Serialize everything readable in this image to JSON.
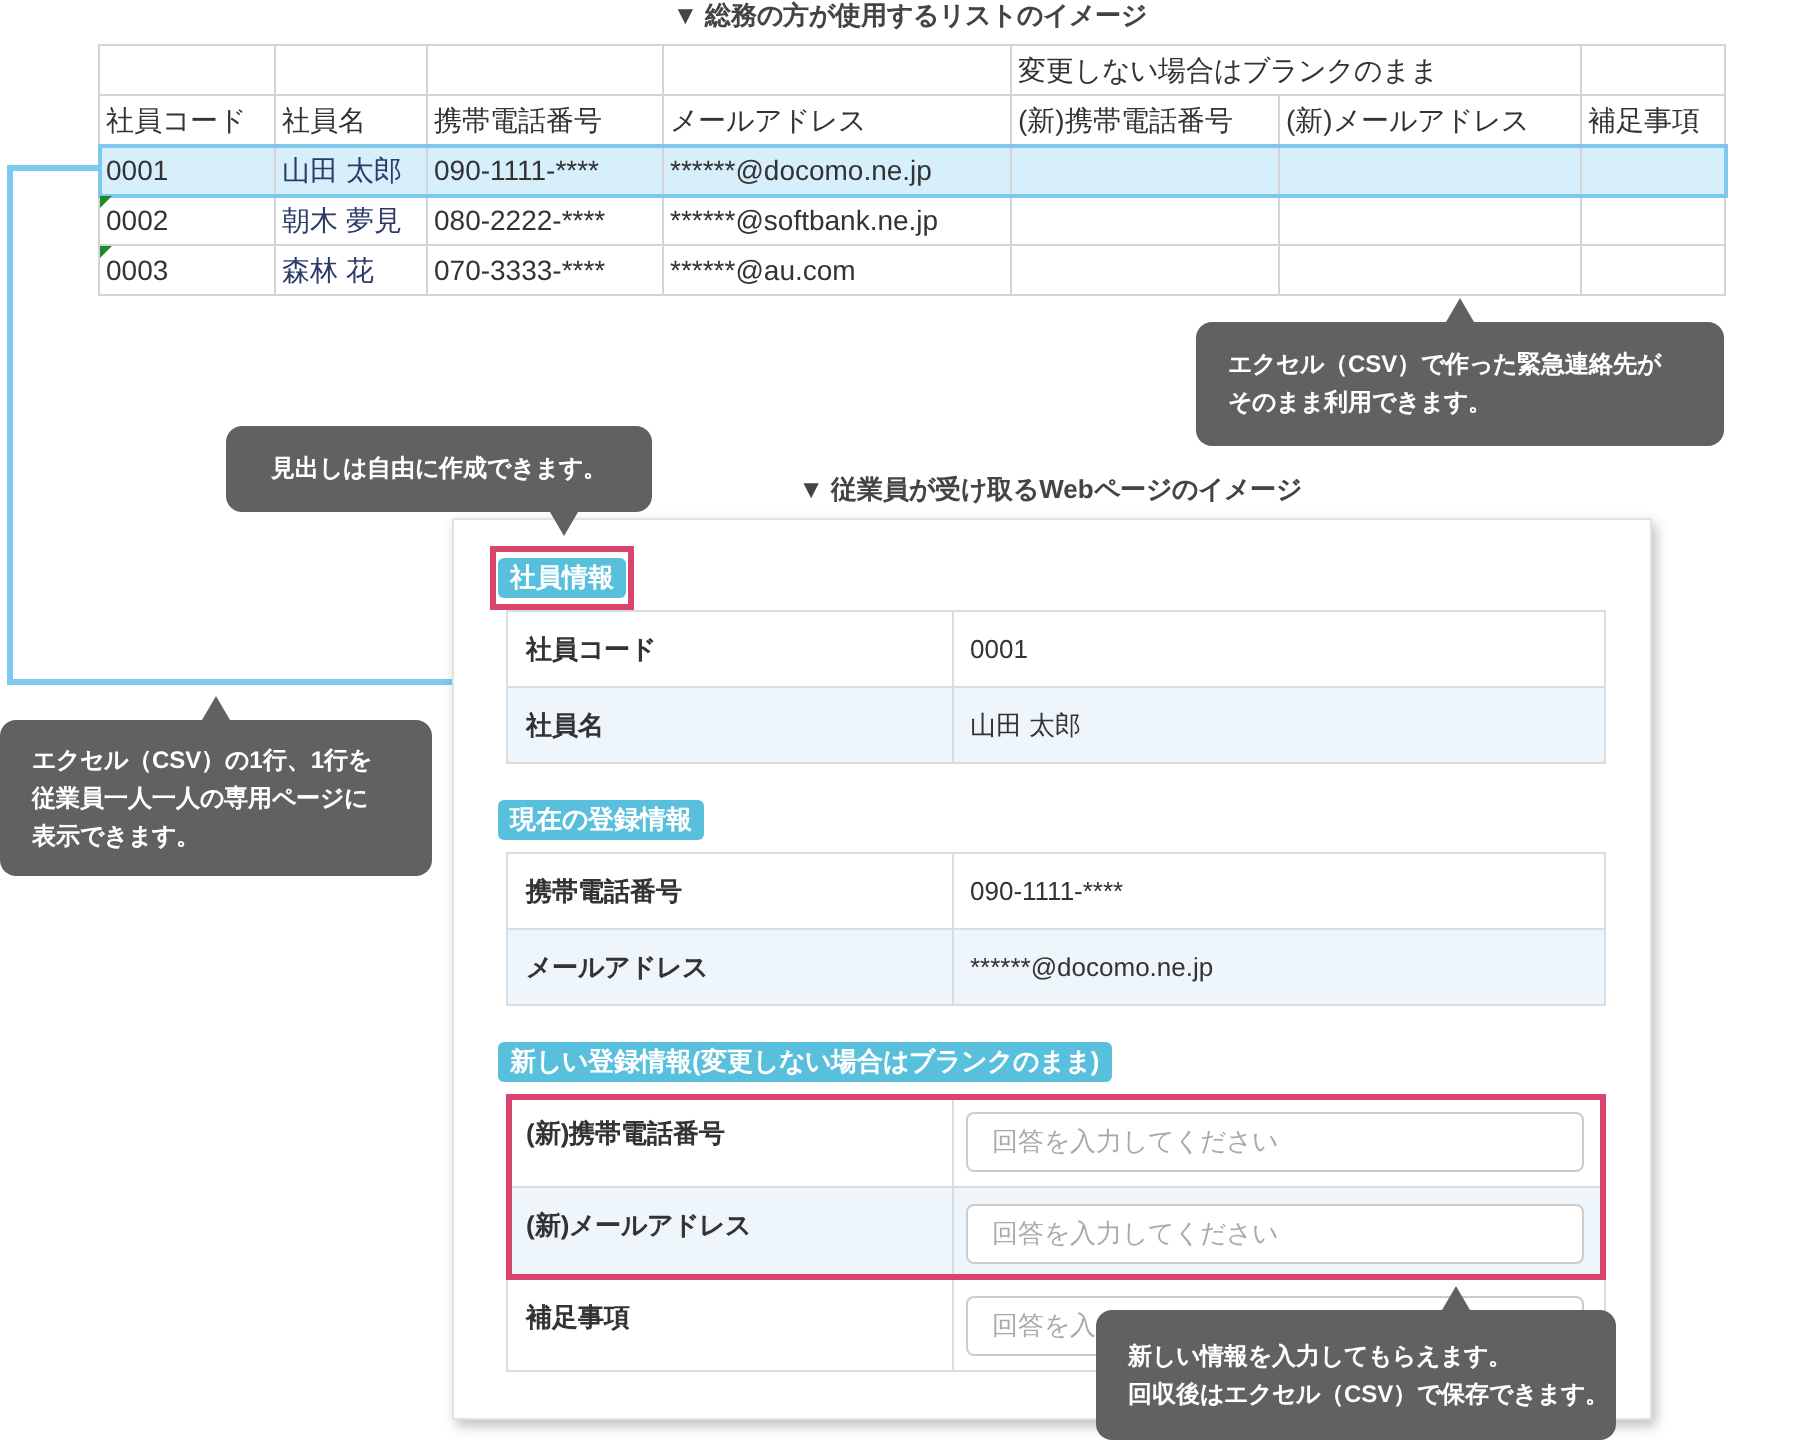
{
  "list_title": "▼ 総務の方が使用するリストのイメージ",
  "spreadsheet": {
    "group_header": "変更しない場合はブランクのまま",
    "columns": [
      "社員コード",
      "社員名",
      "携帯電話番号",
      "メールアドレス",
      "(新)携帯電話番号",
      "(新)メールアドレス",
      "補足事項"
    ],
    "rows": [
      {
        "cells": [
          "0001",
          "山田 太郎",
          "090-1111-****",
          "******@docomo.ne.jp"
        ],
        "selected": true,
        "marked": false
      },
      {
        "cells": [
          "0002",
          "朝木 夢見",
          "080-2222-****",
          "******@softbank.ne.jp"
        ],
        "selected": false,
        "marked": true
      },
      {
        "cells": [
          "0003",
          "森林 花",
          "070-3333-****",
          "******@au.com"
        ],
        "selected": false,
        "marked": true
      }
    ]
  },
  "page_title": "▼ 従業員が受け取るWebページのイメージ",
  "page": {
    "sections": [
      {
        "heading": "社員情報",
        "highlighted": true,
        "rows": [
          {
            "kind": "text",
            "label": "社員コード",
            "value": "0001",
            "highlighted": false
          },
          {
            "kind": "text",
            "label": "社員名",
            "value": "山田 太郎",
            "highlighted": false
          }
        ]
      },
      {
        "heading": "現在の登録情報",
        "highlighted": false,
        "rows": [
          {
            "kind": "text",
            "label": "携帯電話番号",
            "value": "090-1111-****",
            "highlighted": false
          },
          {
            "kind": "text",
            "label": "メールアドレス",
            "value": "******@docomo.ne.jp",
            "highlighted": false
          }
        ]
      },
      {
        "heading": "新しい登録情報(変更しない場合はブランクのまま)",
        "highlighted": false,
        "rows": [
          {
            "kind": "input",
            "label": "(新)携帯電話番号",
            "placeholder": "回答を入力してください",
            "highlighted": true
          },
          {
            "kind": "input",
            "label": "(新)メールアドレス",
            "placeholder": "回答を入力してください",
            "highlighted": true
          },
          {
            "kind": "input",
            "label": "補足事項",
            "placeholder": "回答を入",
            "highlighted": false
          }
        ]
      }
    ]
  },
  "callouts": [
    {
      "lines": [
        "エクセル（CSV）で作った緊急連絡先が",
        "そのまま利用できます。"
      ]
    },
    {
      "lines": [
        "見出しは自由に作成できます。"
      ]
    },
    {
      "lines": [
        "エクセル（CSV）の1行、1行を",
        "従業員一人一人の専用ページに",
        "表示できます。"
      ]
    },
    {
      "lines": [
        "新しい情報を入力してもらえます。",
        "回収後はエクセル（CSV）で保存できます。"
      ]
    }
  ]
}
